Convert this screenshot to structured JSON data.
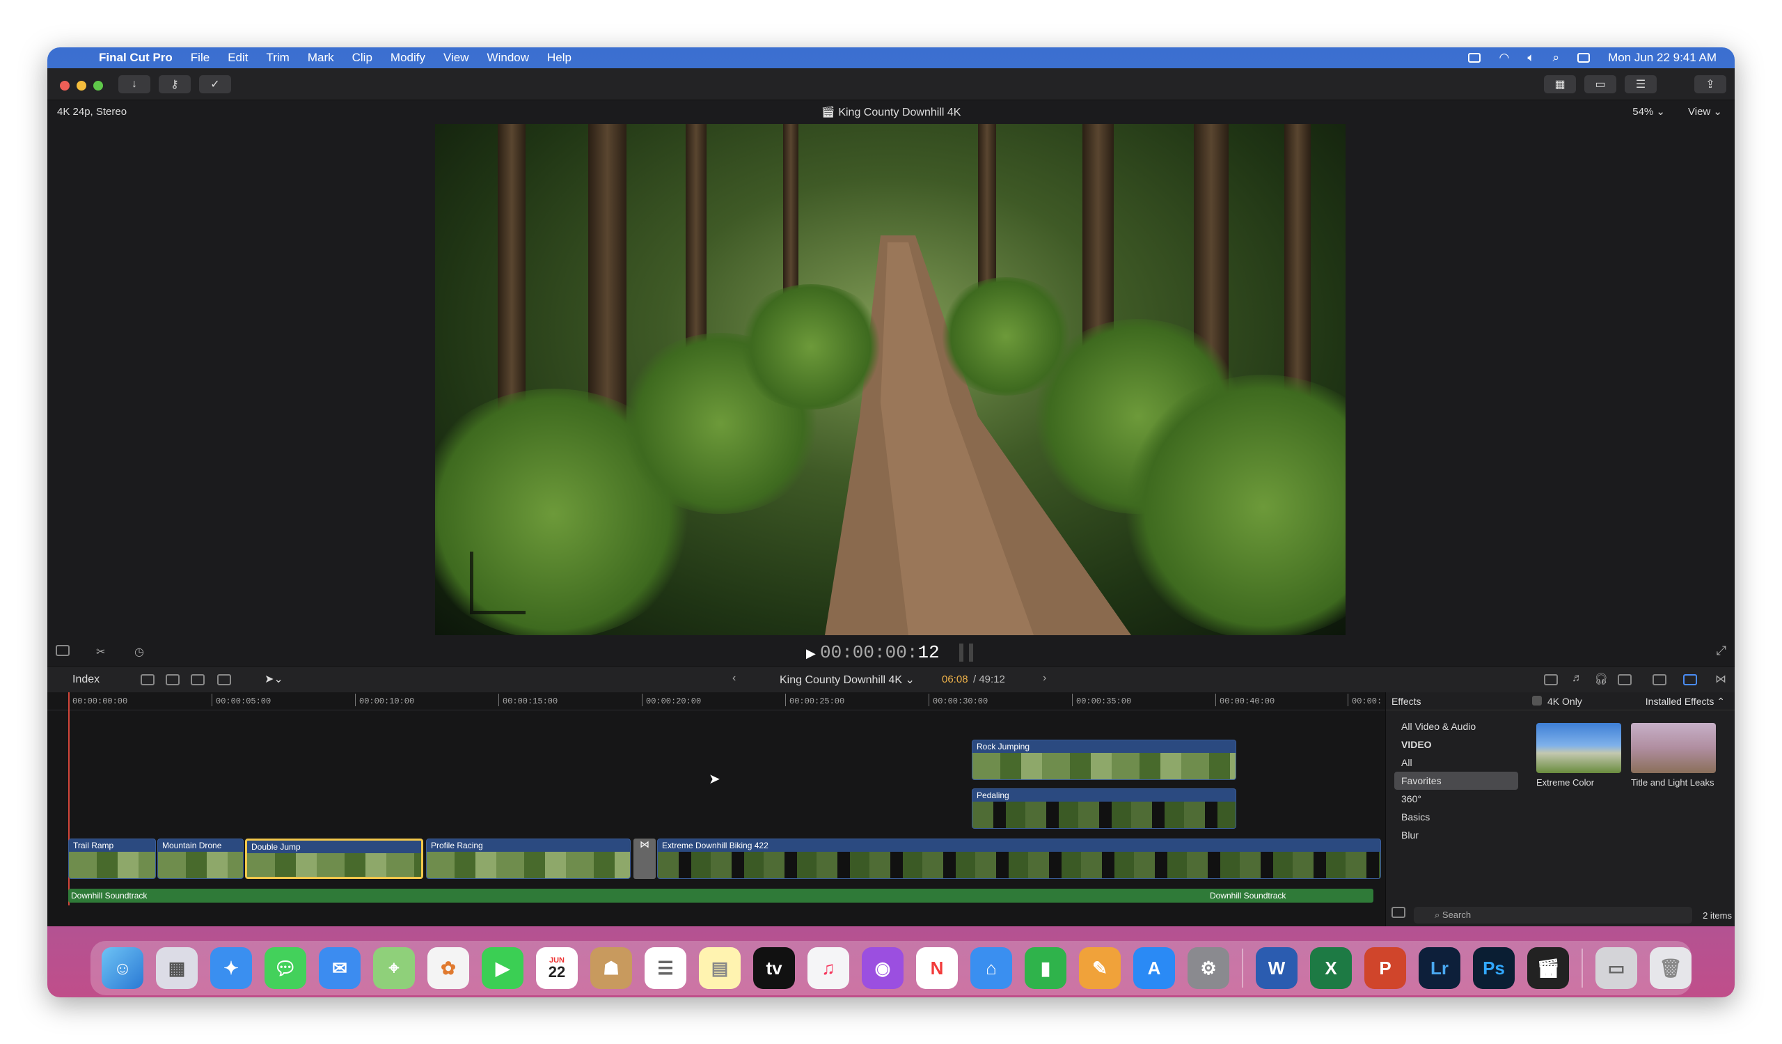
{
  "menubar": {
    "app": "Final Cut Pro",
    "items": [
      "File",
      "Edit",
      "Trim",
      "Mark",
      "Clip",
      "Modify",
      "View",
      "Window",
      "Help"
    ],
    "clock": "Mon Jun 22  9:41 AM"
  },
  "viewer": {
    "format": "4K 24p, Stereo",
    "title": "King County Downhill 4K",
    "zoom": "54% ⌄",
    "view": "View ⌄"
  },
  "transport": {
    "timecode_dim": "00:00:00:",
    "timecode_frames": "12"
  },
  "timeline_bar": {
    "index": "Index",
    "project": "King County Downhill 4K ⌄",
    "current": "06:08",
    "duration": "/ 49:12"
  },
  "ruler": [
    "00:00:00:00",
    "00:00:05:00",
    "00:00:10:00",
    "00:00:15:00",
    "00:00:20:00",
    "00:00:25:00",
    "00:00:30:00",
    "00:00:35:00",
    "00:00:40:00",
    "00:00:"
  ],
  "clips": {
    "rock": "Rock Jumping",
    "pedaling": "Pedaling",
    "trail": "Trail Ramp",
    "drone": "Mountain Drone",
    "jump": "Double Jump",
    "profile": "Profile Racing",
    "extreme": "Extreme Downhill Biking 422"
  },
  "audio": {
    "a1": "Downhill Soundtrack",
    "a2": "Downhill Soundtrack"
  },
  "effects": {
    "title": "Effects",
    "filter": "4K Only",
    "installed": "Installed Effects ⌃",
    "categories": [
      "All Video & Audio",
      "VIDEO",
      "All",
      "Favorites",
      "360°",
      "Basics",
      "Blur"
    ],
    "thumb1": "Extreme Color",
    "thumb2": "Title and Light Leaks",
    "search": "Search",
    "count": "2 items"
  },
  "dock": {
    "calendar_month": "JUN",
    "calendar_day": "22",
    "word": "W",
    "excel": "X",
    "powerpoint": "P",
    "lightroom": "Lr",
    "photoshop": "Ps"
  }
}
